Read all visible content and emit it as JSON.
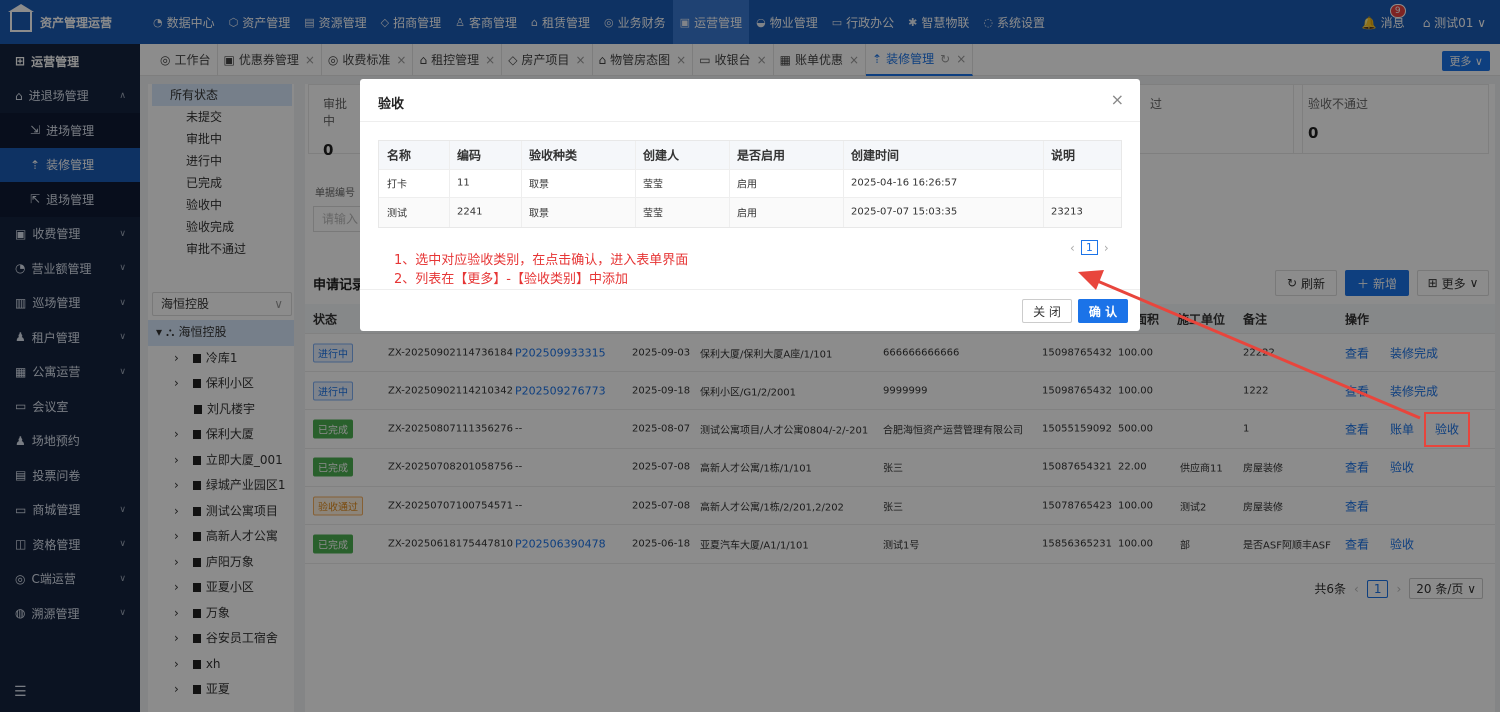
{
  "app": {
    "title": "资产管理运营"
  },
  "nav": [
    {
      "icon": "◔",
      "label": "数据中心"
    },
    {
      "icon": "⬡",
      "label": "资产管理"
    },
    {
      "icon": "▤",
      "label": "资源管理"
    },
    {
      "icon": "◇",
      "label": "招商管理"
    },
    {
      "icon": "♙",
      "label": "客商管理"
    },
    {
      "icon": "⌂",
      "label": "租赁管理"
    },
    {
      "icon": "◎",
      "label": "业务财务"
    },
    {
      "icon": "▣",
      "label": "运营管理"
    },
    {
      "icon": "◒",
      "label": "物业管理"
    },
    {
      "icon": "▭",
      "label": "行政办公"
    },
    {
      "icon": "✱",
      "label": "智慧物联"
    },
    {
      "icon": "◌",
      "label": "系统设置"
    }
  ],
  "topright": {
    "message_label": "消息",
    "message_count": "9",
    "user": "测试01 ∨"
  },
  "sidebar": {
    "header": "运营管理",
    "items": [
      {
        "label": "进退场管理",
        "icon": "⌂",
        "chev": "∧",
        "type": "group"
      },
      {
        "label": "进场管理",
        "icon": "⇲",
        "type": "sub"
      },
      {
        "label": "装修管理",
        "icon": "⇡",
        "type": "sub"
      },
      {
        "label": "退场管理",
        "icon": "⇱",
        "type": "sub"
      },
      {
        "label": "收费管理",
        "icon": "▣",
        "chev": "∨",
        "type": "group"
      },
      {
        "label": "营业额管理",
        "icon": "◔",
        "chev": "∨",
        "type": "group"
      },
      {
        "label": "巡场管理",
        "icon": "▥",
        "chev": "∨",
        "type": "group"
      },
      {
        "label": "租户管理",
        "icon": "♟",
        "chev": "∨",
        "type": "group"
      },
      {
        "label": "公寓运营",
        "icon": "▦",
        "chev": "∨",
        "type": "group"
      },
      {
        "label": "会议室",
        "icon": "▭",
        "type": "group"
      },
      {
        "label": "场地预约",
        "icon": "♟",
        "type": "group"
      },
      {
        "label": "投票问卷",
        "icon": "▤",
        "type": "group"
      },
      {
        "label": "商城管理",
        "icon": "▭",
        "chev": "∨",
        "type": "group"
      },
      {
        "label": "资格管理",
        "icon": "◫",
        "chev": "∨",
        "type": "group"
      },
      {
        "label": "C端运营",
        "icon": "◎",
        "chev": "∨",
        "type": "group"
      },
      {
        "label": "溯源管理",
        "icon": "◍",
        "chev": "∨",
        "type": "group"
      }
    ],
    "collapse": "☰"
  },
  "tabs": [
    {
      "icon": "◎",
      "label": "工作台"
    },
    {
      "icon": "▣",
      "label": "优惠券管理"
    },
    {
      "icon": "◎",
      "label": "收费标准"
    },
    {
      "icon": "⌂",
      "label": "租控管理"
    },
    {
      "icon": "◇",
      "label": "房产项目"
    },
    {
      "icon": "⌂",
      "label": "物管房态图"
    },
    {
      "icon": "▭",
      "label": "收银台"
    },
    {
      "icon": "▦",
      "label": "账单优惠"
    },
    {
      "icon": "⇡",
      "label": "装修管理",
      "active": true
    }
  ],
  "tab_more": "更多 ∨",
  "status_tree": {
    "root": "所有状态",
    "items": [
      "未提交",
      "审批中",
      "进行中",
      "已完成",
      "验收中",
      "验收完成",
      "审批不通过"
    ]
  },
  "org": {
    "select": "海恒控股",
    "root": "海恒控股",
    "items": [
      "冷库1",
      "保利小区",
      "刘凡楼宇",
      "保利大厦",
      "立即大厦_001",
      "绿城产业园区1",
      "测试公寓项目",
      "高新人才公寓",
      "庐阳万象",
      "亚夏小区",
      "万象",
      "谷安员工宿舍",
      "xh",
      "亚夏"
    ]
  },
  "stats": [
    {
      "label": "审批中",
      "value": "0"
    },
    {
      "label": "过",
      "value": ""
    },
    {
      "label": "验收不通过",
      "value": "0"
    }
  ],
  "search": {
    "label": "单据编号",
    "placeholder": "请输入"
  },
  "records": {
    "title": "申请记录",
    "refresh": "刷新",
    "add": "新增",
    "more": "更多"
  },
  "table": {
    "headers": [
      "状态",
      "面积",
      "施工单位",
      "备注",
      "操作"
    ],
    "rows": [
      {
        "status": "进行中",
        "stype": "ing",
        "code": "ZX-20250902114736184",
        "link": "P202509933315",
        "date": "2025-09-03",
        "location": "保利大厦/保利大厦A座/1/101",
        "tenant": "666666666666",
        "phone": "15098765432",
        "area": "100.00",
        "builder": "",
        "remark": "22222",
        "ops": [
          "查看",
          "装修完成"
        ]
      },
      {
        "status": "进行中",
        "stype": "ing",
        "code": "ZX-20250902114210342",
        "link": "P202509276773",
        "date": "2025-09-18",
        "location": "保利小区/G1/2/2001",
        "tenant": "9999999",
        "phone": "15098765432",
        "area": "100.00",
        "builder": "",
        "remark": "1222",
        "ops": [
          "查看",
          "装修完成"
        ]
      },
      {
        "status": "已完成",
        "stype": "done",
        "code": "ZX-20250807111356276",
        "link": "--",
        "date": "2025-08-07",
        "location": "测试公寓项目/人才公寓0804/-2/-201",
        "tenant": "合肥海恒资产运营管理有限公司",
        "phone": "15055159092",
        "area": "500.00",
        "builder": "",
        "remark": "1",
        "ops": [
          "查看",
          "账单",
          "验收"
        ]
      },
      {
        "status": "已完成",
        "stype": "done",
        "code": "ZX-20250708201058756",
        "link": "--",
        "date": "2025-07-08",
        "location": "高新人才公寓/1栋/1/101",
        "tenant": "张三",
        "phone": "15087654321",
        "area": "22.00",
        "builder": "供应商11",
        "remark": "房屋装修",
        "ops": [
          "查看",
          "验收"
        ]
      },
      {
        "status": "验收通过",
        "stype": "pass",
        "code": "ZX-20250707100754571",
        "link": "--",
        "date": "2025-07-08",
        "location": "高新人才公寓/1栋/2/201,2/202",
        "tenant": "张三",
        "phone": "15078765423",
        "area": "100.00",
        "builder": "测试2",
        "remark": "房屋装修",
        "ops": [
          "查看"
        ]
      },
      {
        "status": "已完成",
        "stype": "done",
        "code": "ZX-20250618175447810",
        "link": "P202506390478",
        "date": "2025-06-18",
        "location": "亚夏汽车大厦/A1/1/101",
        "tenant": "测试1号",
        "phone": "15856365231",
        "area": "100.00",
        "builder": "部",
        "remark": "是否ASF阿顺丰ASF",
        "ops": [
          "查看",
          "验收"
        ]
      }
    ]
  },
  "pager": {
    "total": "共6条",
    "page": "1",
    "size": "20 条/页 ∨"
  },
  "modal": {
    "title": "验收",
    "close": "×",
    "headers": [
      "名称",
      "编码",
      "验收种类",
      "创建人",
      "是否启用",
      "创建时间",
      "说明"
    ],
    "rows": [
      [
        "打卡",
        "11",
        "取景",
        "莹莹",
        "启用",
        "2025-04-16 16:26:57",
        ""
      ],
      [
        "测试",
        "2241",
        "取景",
        "莹莹",
        "启用",
        "2025-07-07 15:03:35",
        "23213"
      ]
    ],
    "note1": "1、选中对应验收类别，在点击确认，进入表单界面",
    "note2": "2、列表在【更多】-【验收类别】中添加",
    "page": "1",
    "cancel": "关 闭",
    "confirm": "确 认"
  },
  "colors": {
    "primary": "#1b73e8",
    "topbar": "#1b5bb4",
    "sidebar": "#14233f",
    "annotation": "#e8453c"
  }
}
